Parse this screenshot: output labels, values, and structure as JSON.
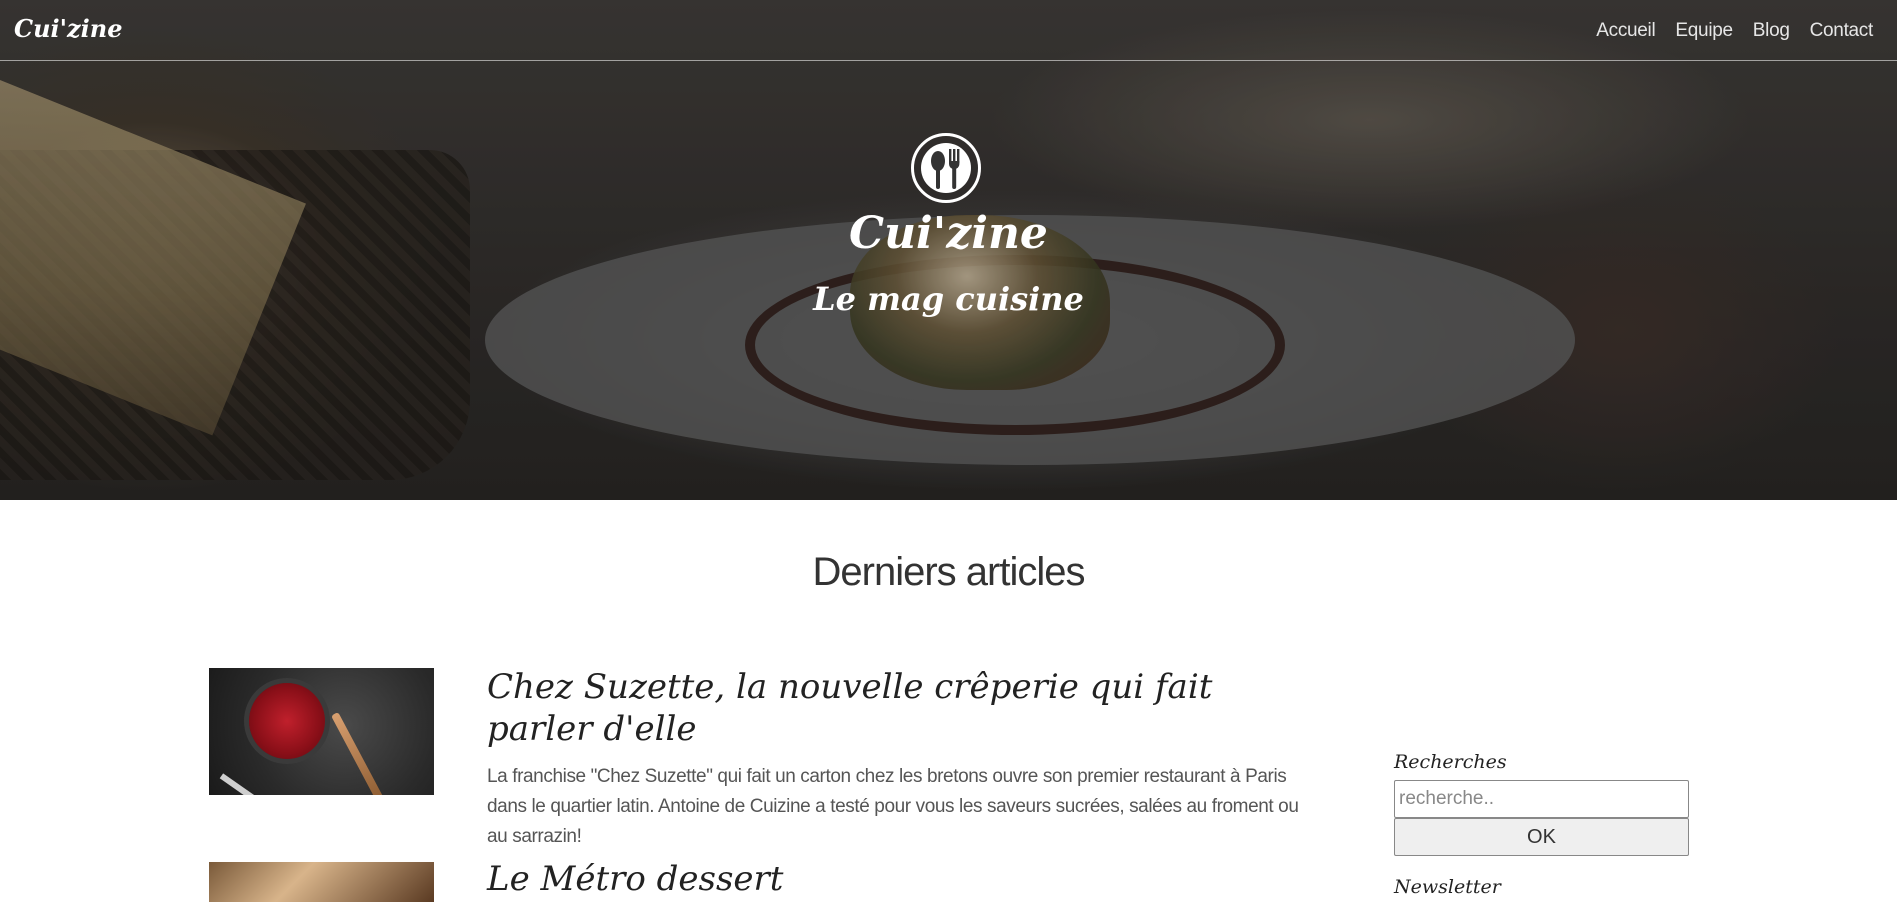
{
  "brand": "Cui'zine",
  "nav": {
    "items": [
      {
        "label": "Accueil"
      },
      {
        "label": "Equipe"
      },
      {
        "label": "Blog"
      },
      {
        "label": "Contact"
      }
    ]
  },
  "hero": {
    "logo_icon": "spoon-fork-icon",
    "title": "Cui'zine",
    "subtitle": "Le mag cuisine"
  },
  "section": {
    "title": "Derniers articles"
  },
  "articles": [
    {
      "title": "Chez Suzette, la nouvelle crêperie qui fait parler d'elle",
      "excerpt": "La franchise \"Chez Suzette\" qui fait un carton chez les bretons ouvre son premier restaurant à Paris dans le quartier latin. Antoine de Cuizine a testé pour vous les saveurs sucrées, salées au froment ou au sarrazin!"
    },
    {
      "title": "Le Métro dessert"
    }
  ],
  "sidebar": {
    "search": {
      "label": "Recherches",
      "placeholder": "recherche..",
      "button": "OK"
    },
    "newsletter": {
      "label": "Newsletter"
    }
  },
  "colors": {
    "text": "#333333",
    "hero_overlay": "#2f2c2a",
    "white": "#ffffff"
  }
}
